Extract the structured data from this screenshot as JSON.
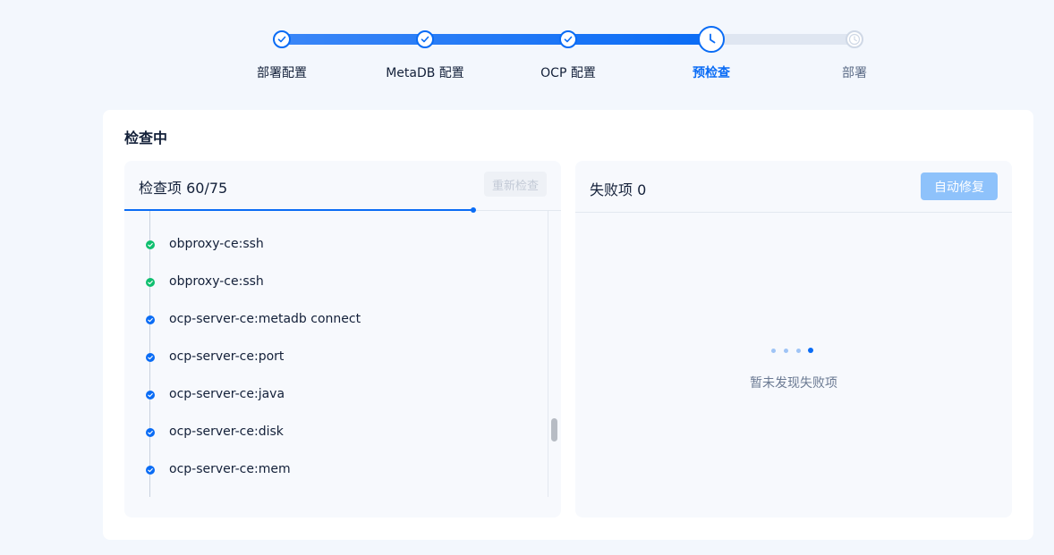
{
  "stepper": {
    "steps": [
      {
        "label": "部署配置",
        "status": "done"
      },
      {
        "label": "MetaDB 配置",
        "status": "done"
      },
      {
        "label": "OCP 配置",
        "status": "done"
      },
      {
        "label": "预检查",
        "status": "active"
      },
      {
        "label": "部署",
        "status": "pending"
      }
    ]
  },
  "main": {
    "title": "检查中",
    "left_panel": {
      "title": "检查项 60/75",
      "recheck_label": "重新检查",
      "progress": 0.8,
      "items": [
        {
          "name": "obproxy-ce:ssh",
          "status": "success"
        },
        {
          "name": "obproxy-ce:ssh",
          "status": "success"
        },
        {
          "name": "ocp-server-ce:metadb connect",
          "status": "checking"
        },
        {
          "name": "ocp-server-ce:port",
          "status": "checking"
        },
        {
          "name": "ocp-server-ce:java",
          "status": "checking"
        },
        {
          "name": "ocp-server-ce:disk",
          "status": "checking"
        },
        {
          "name": "ocp-server-ce:mem",
          "status": "checking"
        }
      ]
    },
    "right_panel": {
      "title": "失败项 0",
      "autofix_label": "自动修复",
      "empty_text": "暂未发现失败项"
    }
  },
  "colors": {
    "primary": "#0a6cf5",
    "success": "#0fbf6f",
    "background": "#f3f7fd"
  }
}
